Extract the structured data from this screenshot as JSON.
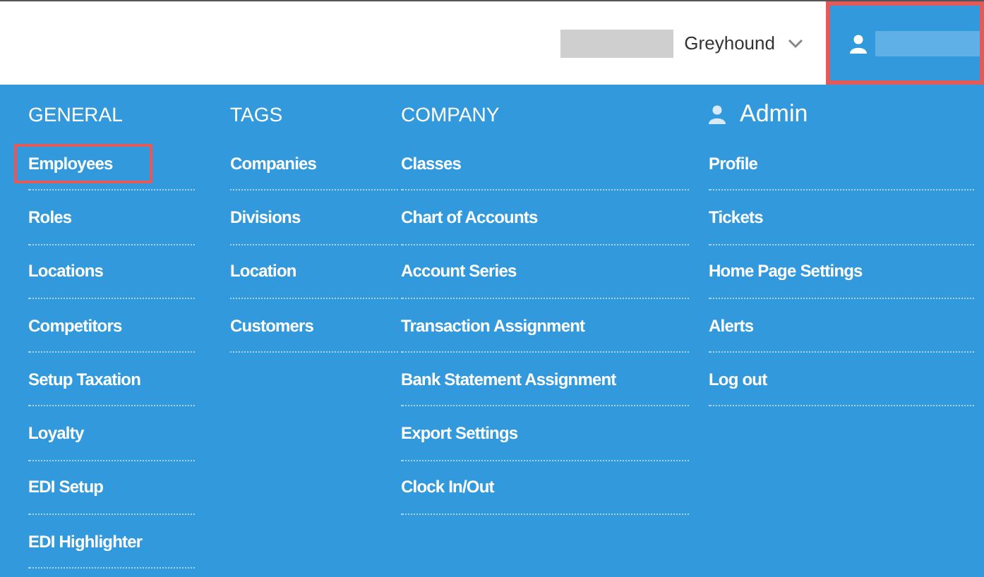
{
  "top_bar": {
    "company": "Greyhound",
    "user_box_highlighted": true
  },
  "columns": [
    {
      "title": "GENERAL",
      "kind": "plain",
      "items": [
        {
          "label": "Employees",
          "highlighted": true
        },
        {
          "label": "Roles",
          "highlighted": false
        },
        {
          "label": "Locations",
          "highlighted": false
        },
        {
          "label": "Competitors",
          "highlighted": false
        },
        {
          "label": "Setup Taxation",
          "highlighted": false
        },
        {
          "label": "Loyalty",
          "highlighted": false
        },
        {
          "label": "EDI Setup",
          "highlighted": false
        },
        {
          "label": "EDI Highlighter",
          "highlighted": false
        }
      ]
    },
    {
      "title": "TAGS",
      "kind": "plain",
      "items": [
        {
          "label": "Companies",
          "highlighted": false
        },
        {
          "label": "Divisions",
          "highlighted": false
        },
        {
          "label": "Location",
          "highlighted": false
        },
        {
          "label": "Customers",
          "highlighted": false
        }
      ]
    },
    {
      "title": "COMPANY",
      "kind": "plain",
      "items": [
        {
          "label": "Classes",
          "highlighted": false
        },
        {
          "label": "Chart of Accounts",
          "highlighted": false
        },
        {
          "label": "Account Series",
          "highlighted": false
        },
        {
          "label": "Transaction Assignment",
          "highlighted": false
        },
        {
          "label": "Bank Statement Assignment",
          "highlighted": false
        },
        {
          "label": "Export Settings",
          "highlighted": false
        },
        {
          "label": "Clock In/Out",
          "highlighted": false
        }
      ]
    },
    {
      "title": "Admin",
      "kind": "user",
      "items": [
        {
          "label": "Profile",
          "highlighted": false
        },
        {
          "label": "Tickets",
          "highlighted": false
        },
        {
          "label": "Home Page Settings",
          "highlighted": false
        },
        {
          "label": "Alerts",
          "highlighted": false
        },
        {
          "label": "Log out",
          "highlighted": false
        }
      ]
    }
  ]
}
